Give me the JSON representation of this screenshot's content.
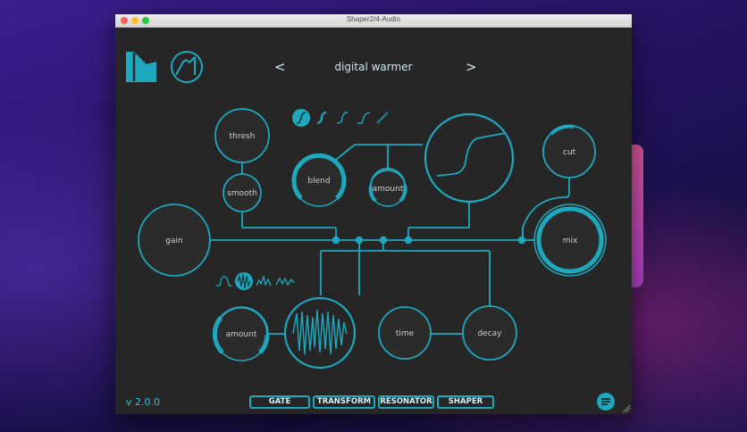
{
  "window": {
    "title": "Shaper2/4-Audio"
  },
  "header": {
    "preset_name": "digital warmer",
    "prev_label": "<",
    "next_label": ">"
  },
  "knobs": {
    "thresh": "thresh",
    "smooth": "smooth",
    "blend": "blend",
    "amount_top": "amount",
    "cut": "cut",
    "gain": "gain",
    "mix": "mix",
    "amount_bottom": "amount",
    "time": "time",
    "decay": "decay"
  },
  "footer": {
    "version": "v 2.0.0",
    "tabs": [
      "GATE",
      "TRANSFORM",
      "RESONATOR",
      "SHAPER"
    ]
  },
  "colors": {
    "accent": "#1ea8bd",
    "panel": "#262626",
    "knob_fill": "#2b2b2b"
  }
}
